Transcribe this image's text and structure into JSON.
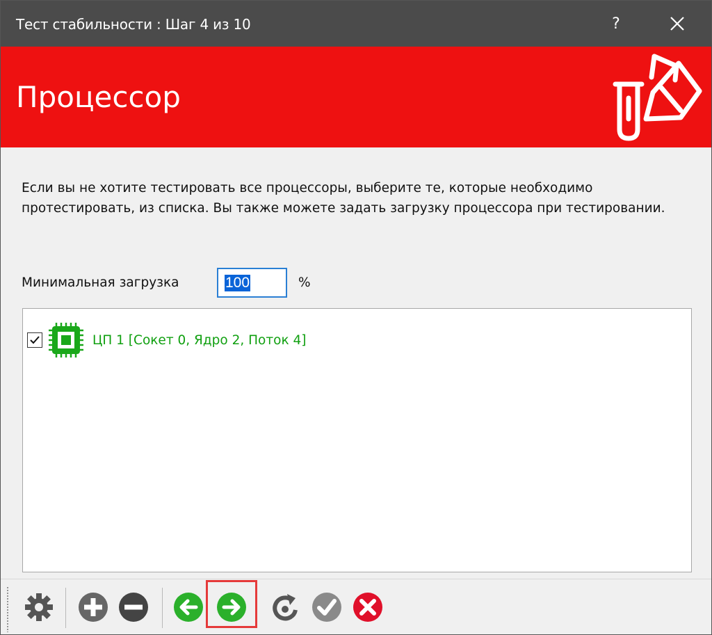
{
  "window": {
    "title": "Тест стабильности : Шаг 4 из 10",
    "help_label": "?"
  },
  "banner": {
    "heading": "Процессор",
    "icon": "test-tubes-icon",
    "background_color": "#ee1111"
  },
  "content": {
    "description": "Если вы не хотите тестировать все процессоры, выберите те, которые необходимо протестировать, из списка. Вы также можете задать загрузку процессора при тестировании.",
    "min_load_label": "Минимальная загрузка",
    "min_load_value": "100",
    "percent_sign": "%"
  },
  "cpu_list": {
    "items": [
      {
        "label": "ЦП 1 [Сокет 0, Ядро 2, Поток 4]",
        "checked": true,
        "icon": "cpu-chip-icon",
        "color": "#10a010"
      }
    ]
  },
  "toolbar": {
    "buttons": [
      {
        "name": "settings",
        "icon": "gear-icon"
      },
      {
        "name": "add",
        "icon": "plus-circle-icon"
      },
      {
        "name": "remove",
        "icon": "minus-circle-icon"
      },
      {
        "name": "back",
        "icon": "arrow-left-icon"
      },
      {
        "name": "next",
        "icon": "arrow-right-icon",
        "highlighted": true
      },
      {
        "name": "reset",
        "icon": "refresh-icon"
      },
      {
        "name": "finish",
        "icon": "checkmark-icon"
      },
      {
        "name": "cancel",
        "icon": "cancel-icon"
      }
    ],
    "accent_green": "#2bb02b",
    "accent_red": "#e0102a"
  }
}
